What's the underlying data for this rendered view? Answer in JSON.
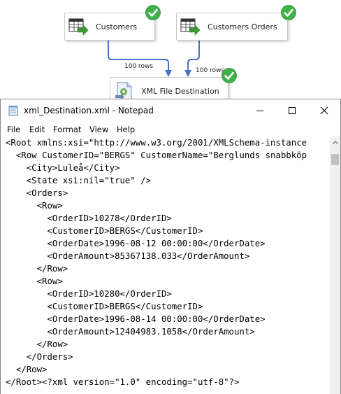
{
  "canvas": {
    "nodes": [
      {
        "id": "customers",
        "label": "Customers"
      },
      {
        "id": "customers-orders",
        "label": "Customers Orders"
      },
      {
        "id": "xml-dest",
        "label": "XML File Destination"
      }
    ],
    "paths": [
      {
        "label": "100 rows"
      },
      {
        "label": "100 rows"
      }
    ],
    "colors": {
      "path": "#4472c4",
      "check": "#3fb24a"
    }
  },
  "notepad": {
    "title": "xml_Destination.xml - Notepad",
    "menu": [
      "File",
      "Edit",
      "Format",
      "View",
      "Help"
    ],
    "lines": [
      "<Root xmlns:xsi=\"http://www.w3.org/2001/XMLSchema-instance",
      "  <Row CustomerID=\"BERGS\" CustomerName=\"Berglunds snabbköp",
      "    <City>Luleå</City>",
      "    <State xsi:nil=\"true\" />",
      "    <Orders>",
      "      <Row>",
      "        <OrderID>10278</OrderID>",
      "        <CustomerID>BERGS</CustomerID>",
      "        <OrderDate>1996-08-12 00:00:00</OrderDate>",
      "        <OrderAmount>85367138.033</OrderAmount>",
      "      </Row>",
      "      <Row>",
      "        <OrderID>10280</OrderID>",
      "        <CustomerID>BERGS</CustomerID>",
      "        <OrderDate>1996-08-14 00:00:00</OrderDate>",
      "        <OrderAmount>12404983.1058</OrderAmount>",
      "      </Row>",
      "    </Orders>",
      "  </Row>",
      "</Root><?xml version=\"1.0\" encoding=\"utf-8\"?>"
    ]
  }
}
